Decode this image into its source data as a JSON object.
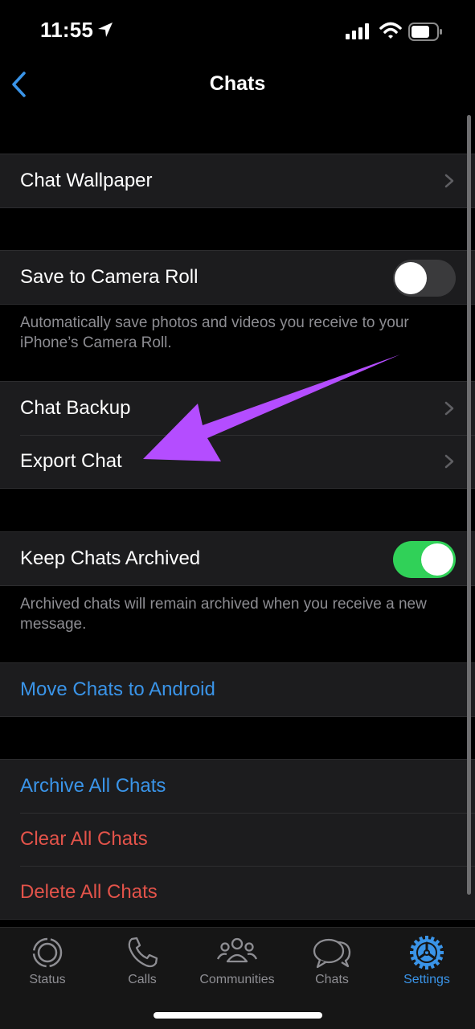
{
  "status_bar": {
    "time": "11:55",
    "icons": [
      "location-arrow-icon",
      "cellular-signal-icon",
      "wifi-icon",
      "battery-icon"
    ]
  },
  "nav": {
    "title": "Chats",
    "back_icon": "chevron-left-icon"
  },
  "sections": {
    "wallpaper": {
      "label": "Chat Wallpaper"
    },
    "camera_roll": {
      "label": "Save to Camera Roll",
      "toggle_on": false,
      "footer": "Automatically save photos and videos you receive to your iPhone’s Camera Roll."
    },
    "backup": {
      "items": [
        {
          "label": "Chat Backup"
        },
        {
          "label": "Export Chat"
        }
      ]
    },
    "archived": {
      "label": "Keep Chats Archived",
      "toggle_on": true,
      "footer": "Archived chats will remain archived when you receive a new message."
    },
    "android": {
      "label": "Move Chats to Android"
    },
    "actions": {
      "archive_all": "Archive All Chats",
      "clear_all": "Clear All Chats",
      "delete_all": "Delete All Chats"
    }
  },
  "annotation": {
    "type": "arrow",
    "points_to": "Export Chat",
    "color": "#b44dff"
  },
  "tabbar": {
    "tabs": [
      {
        "label": "Status",
        "icon": "status-icon",
        "active": false
      },
      {
        "label": "Calls",
        "icon": "phone-icon",
        "active": false
      },
      {
        "label": "Communities",
        "icon": "communities-icon",
        "active": false
      },
      {
        "label": "Chats",
        "icon": "chat-bubbles-icon",
        "active": false
      },
      {
        "label": "Settings",
        "icon": "gear-icon",
        "active": true
      }
    ]
  },
  "colors": {
    "accent_blue": "#3a94e8",
    "destructive_red": "#e3534a",
    "toggle_green": "#30d158",
    "cell_bg": "#1c1c1e"
  }
}
